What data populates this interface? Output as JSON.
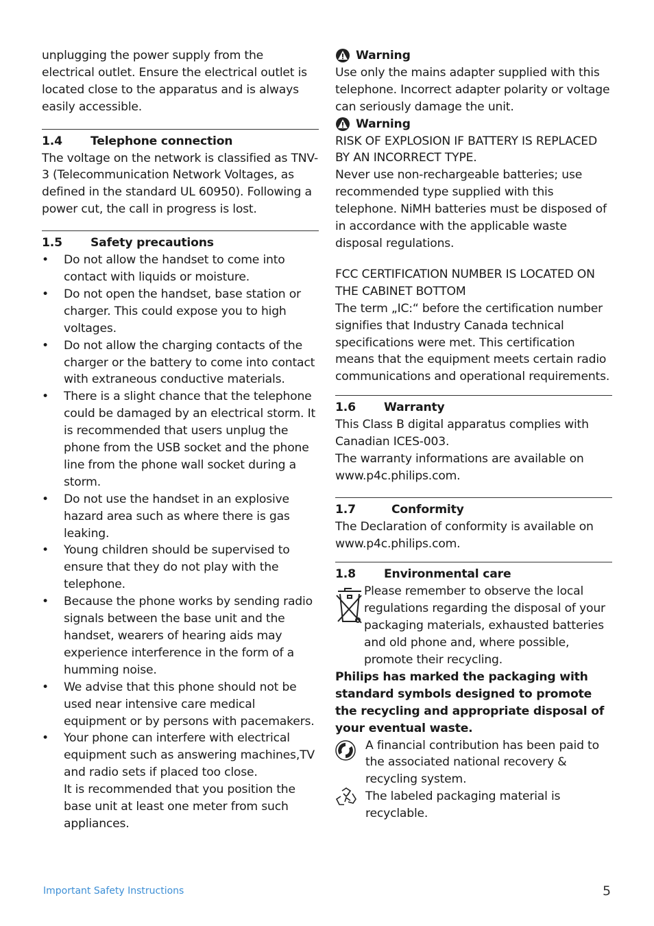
{
  "left_column": {
    "intro": "unplugging the power supply from the electrical outlet. Ensure the electrical outlet is located close to the apparatus and is always easily accessible.",
    "section_1_4": {
      "number": "1.4",
      "title": "Telephone connection",
      "body": "The voltage on the network is classified as TNV-3 (Telecommunication Network Voltages, as defined in the standard UL 60950). Following a power cut, the call in progress is lost."
    },
    "section_1_5": {
      "number": "1.5",
      "title": "Safety precautions",
      "bullets": [
        "Do not allow the handset to come into contact with liquids or moisture.",
        "Do not open the handset, base station or charger. This could expose you to high voltages.",
        "Do not allow the charging contacts of the charger or the battery to come into contact with extraneous conductive materials.",
        "There is a slight chance that the telephone could be damaged by an electrical storm. It is recommended that users unplug the phone from the USB socket and the phone line from the phone wall socket during a storm.",
        "Do not use the handset in an explosive hazard area such as where there is gas leaking.",
        "Young children should be supervised to ensure that they do not play with the telephone.",
        "Because the phone works by sending radio signals between the base unit and the handset, wearers of hearing aids may experience interference in the form of a humming noise.",
        "We advise that this phone should not be used near intensive care medical equipment or by persons with pacemakers.",
        "Your phone can interfere with electrical equipment such as answering machines,TV and radio sets if placed too close."
      ],
      "bullet_continuation": "It is recommended that you position the base unit at least one meter from such appliances."
    }
  },
  "right_column": {
    "warning_1": {
      "title": "Warning",
      "body": "Use only the mains adapter supplied with this telephone. Incorrect adapter polarity or voltage can seriously damage the unit."
    },
    "warning_2": {
      "title": "Warning",
      "caps": "RISK OF EXPLOSION IF BATTERY IS REPLACED BY AN INCORRECT TYPE.",
      "body": "Never use non-rechargeable batteries; use recommended type supplied with this telephone. NiMH batteries must be disposed of in accordance with the applicable waste disposal regulations."
    },
    "fcc": {
      "caps": "FCC CERTIFICATION NUMBER IS LOCATED ON THE CABINET BOTTOM",
      "body": "The term „IC:“ before the certification number signifies that Industry Canada technical specifications were met. This certification means that the equipment meets certain radio communications and operational requirements."
    },
    "section_1_6": {
      "number": "1.6",
      "title": "Warranty",
      "body1": "This Class B digital apparatus complies with Canadian ICES-003.",
      "body2": "The warranty informations are available on www.p4c.philips.com."
    },
    "section_1_7": {
      "number": "1.7",
      "title": "Conformity",
      "body": "The Declaration of conformity is available on www.p4c.philips.com."
    },
    "section_1_8": {
      "number": "1.8",
      "title": "Environmental care",
      "weee_text": "Please remember to observe the local regulations regarding the disposal of your packaging materials, exhausted batteries and old phone and, where possible, promote their recycling.",
      "bold_statement": "Philips has marked the packaging with standard symbols designed to promote the recycling and appropriate disposal of your eventual waste.",
      "green_dot_text": "A financial contribution has been paid to the associated national recovery & recycling system.",
      "recycle_text": "The labeled packaging material is recyclable."
    }
  },
  "footer": {
    "section_label": "Important Safety Instructions",
    "page_number": "5",
    "label_color": "#3d8fd6"
  }
}
